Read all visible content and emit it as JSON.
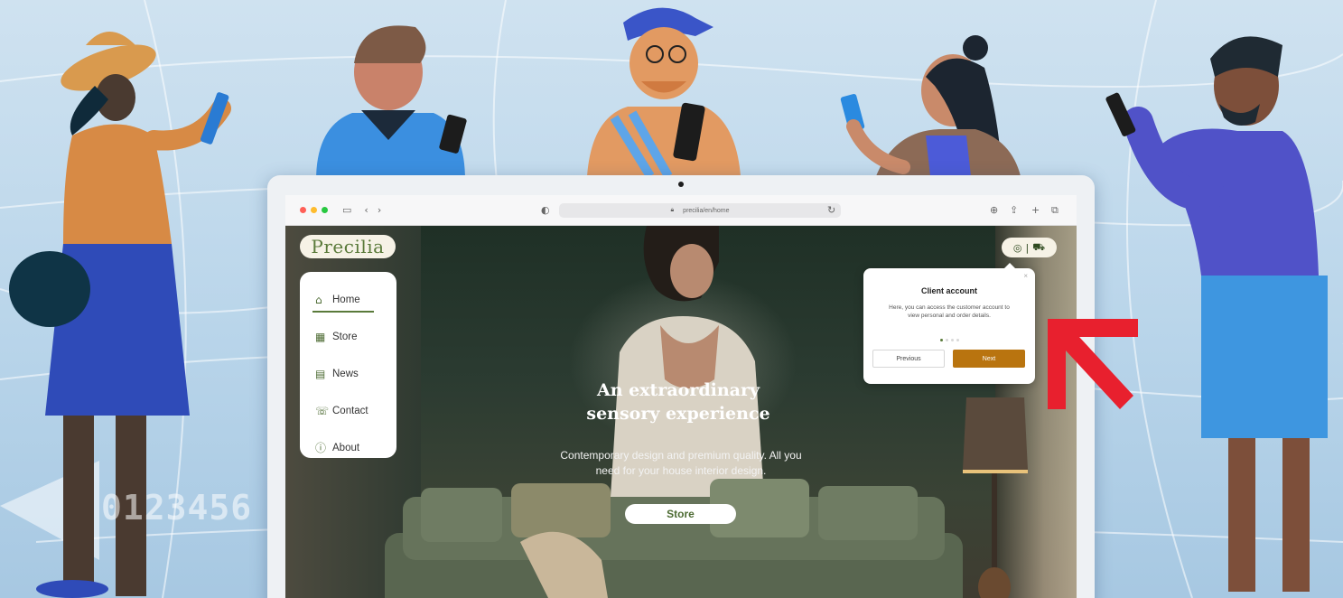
{
  "browser": {
    "url": "precilia/en/home",
    "traffic_colors": [
      "#ff5f57",
      "#febc2e",
      "#28c840"
    ]
  },
  "site": {
    "logo": "Precilia",
    "menu": [
      {
        "label": "Home",
        "icon": "home-icon"
      },
      {
        "label": "Store",
        "icon": "store-icon"
      },
      {
        "label": "News",
        "icon": "news-icon"
      },
      {
        "label": "Contact",
        "icon": "contact-icon"
      },
      {
        "label": "About",
        "icon": "info-icon"
      }
    ],
    "hero_title_line1": "An extraordinary",
    "hero_title_line2": "sensory experience",
    "hero_sub_line1": "Contemporary design and premium quality. All you",
    "hero_sub_line2": "need for your house interior design.",
    "store_button": "Store",
    "accent_color": "#5a7a3a"
  },
  "tour_popover": {
    "title": "Client account",
    "body": "Here, you can access the customer account to view personal and order details.",
    "previous_label": "Previous",
    "next_label": "Next",
    "close": "×",
    "next_color": "#b9740f"
  },
  "overlay": {
    "ticker": "0123456",
    "arrow_color": "#e8202e"
  }
}
